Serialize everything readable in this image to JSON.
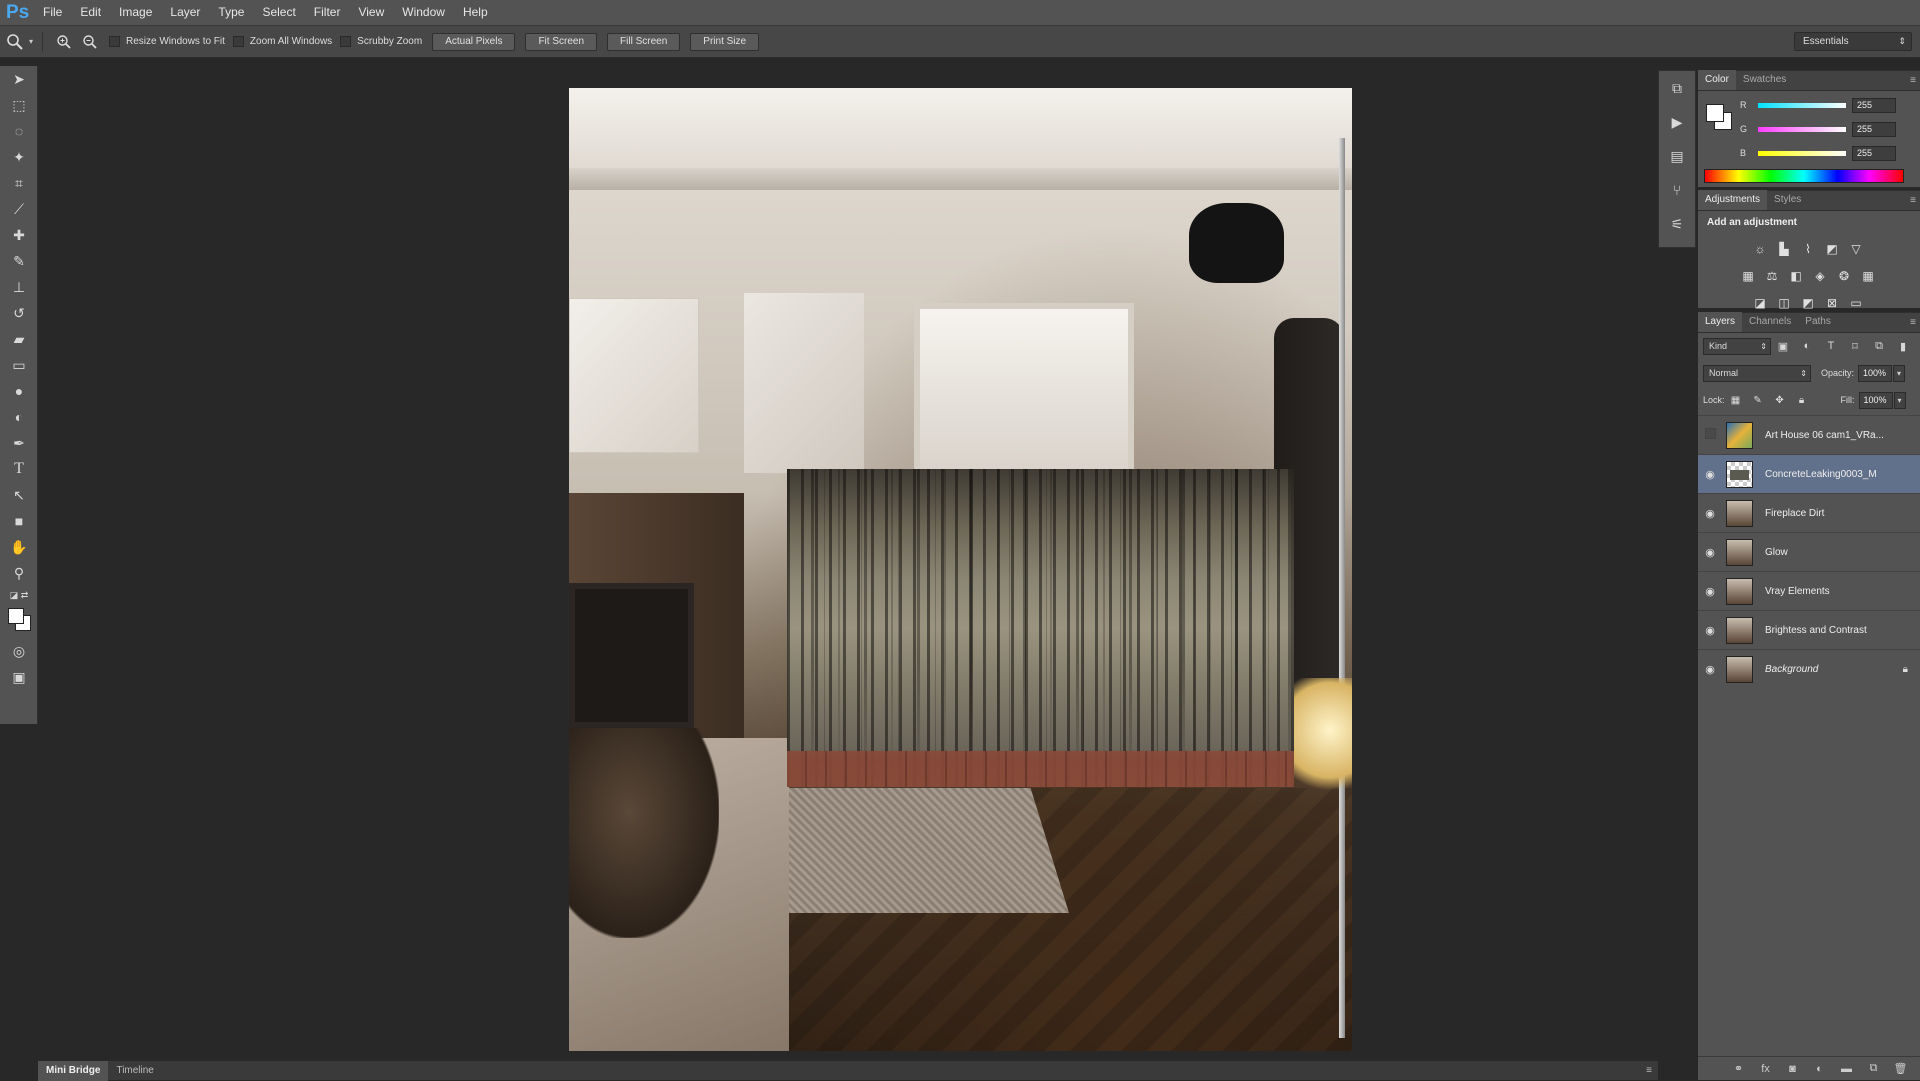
{
  "app": {
    "logo": "Ps"
  },
  "menu": [
    "File",
    "Edit",
    "Image",
    "Layer",
    "Type",
    "Select",
    "Filter",
    "View",
    "Window",
    "Help"
  ],
  "options": {
    "checkboxes": [
      "Resize Windows to Fit",
      "Zoom All Windows",
      "Scrubby Zoom"
    ],
    "buttons": [
      "Actual Pixels",
      "Fit Screen",
      "Fill Screen",
      "Print Size"
    ],
    "workspace": "Essentials"
  },
  "tools": [
    "move-tool-icon",
    "marquee-tool-icon",
    "lasso-tool-icon",
    "magic-wand-tool-icon",
    "crop-tool-icon",
    "eyedropper-tool-icon",
    "healing-brush-tool-icon",
    "brush-tool-icon",
    "clone-stamp-tool-icon",
    "history-brush-tool-icon",
    "eraser-tool-icon",
    "gradient-tool-icon",
    "blur-tool-icon",
    "dodge-tool-icon",
    "pen-tool-icon",
    "type-tool-icon",
    "path-selection-tool-icon",
    "rectangle-tool-icon",
    "hand-tool-icon",
    "zoom-tool-icon"
  ],
  "bottom_tabs": [
    "Mini Bridge",
    "Timeline"
  ],
  "color_panel": {
    "tabs": [
      "Color",
      "Swatches"
    ],
    "channels": [
      {
        "label": "R",
        "value": "255",
        "color": "#00e0ff"
      },
      {
        "label": "G",
        "value": "255",
        "color": "#ff3cff"
      },
      {
        "label": "B",
        "value": "255",
        "color": "#ffff00"
      }
    ]
  },
  "adjustments_panel": {
    "tabs": [
      "Adjustments",
      "Styles"
    ],
    "title": "Add an adjustment"
  },
  "layers_panel": {
    "tabs": [
      "Layers",
      "Channels",
      "Paths"
    ],
    "kind": "Kind",
    "blend_mode": "Normal",
    "opacity_label": "Opacity:",
    "opacity": "100%",
    "lock_label": "Lock:",
    "fill_label": "Fill:",
    "fill": "100%",
    "layers": [
      {
        "name": "Art House 06 cam1_VRa...",
        "visible": false,
        "selected": false,
        "italic": false,
        "locked": false
      },
      {
        "name": "ConcreteLeaking0003_M",
        "visible": true,
        "selected": true,
        "italic": false,
        "locked": false
      },
      {
        "name": "Fireplace Dirt",
        "visible": true,
        "selected": false,
        "italic": false,
        "locked": false
      },
      {
        "name": "Glow",
        "visible": true,
        "selected": false,
        "italic": false,
        "locked": false
      },
      {
        "name": "Vray Elements",
        "visible": true,
        "selected": false,
        "italic": false,
        "locked": false
      },
      {
        "name": "Brightess and Contrast",
        "visible": true,
        "selected": false,
        "italic": false,
        "locked": false
      },
      {
        "name": "Background",
        "visible": true,
        "selected": false,
        "italic": true,
        "locked": true
      }
    ]
  }
}
